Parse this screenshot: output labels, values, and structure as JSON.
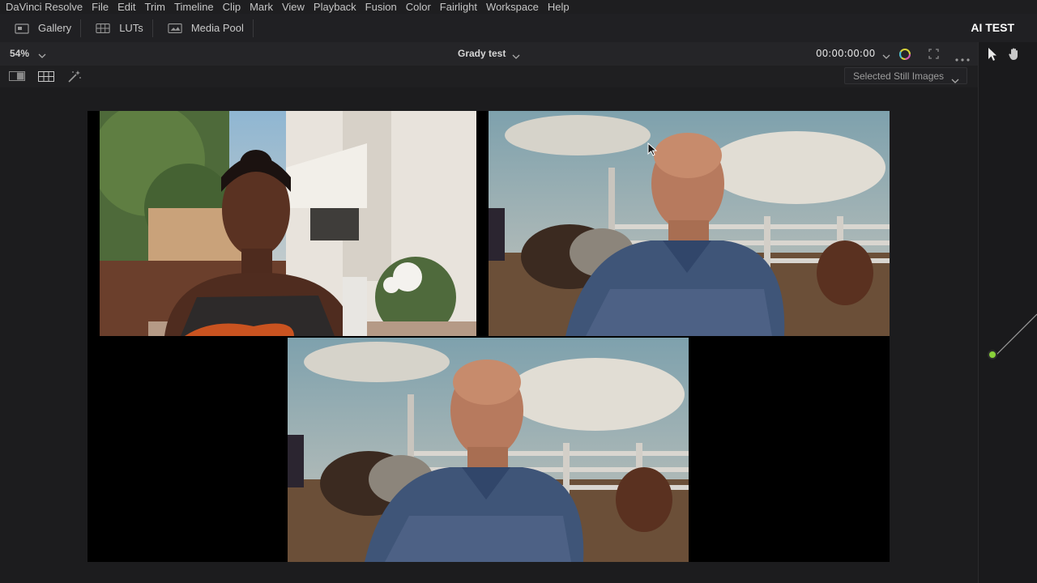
{
  "menu": [
    "DaVinci Resolve",
    "File",
    "Edit",
    "Trim",
    "Timeline",
    "Clip",
    "Mark",
    "View",
    "Playback",
    "Fusion",
    "Color",
    "Fairlight",
    "Workspace",
    "Help"
  ],
  "toolbar": {
    "gallery_label": "Gallery",
    "luts_label": "LUTs",
    "media_pool_label": "Media Pool"
  },
  "project_name": "AI TEST",
  "viewer_bar": {
    "zoom": "54%",
    "clip_name": "Grady test",
    "timecode": "00:00:00:00"
  },
  "gallery": {
    "still_filter": "Selected Still Images"
  },
  "icons": [
    "gallery-icon",
    "luts-icon",
    "media-pool-icon",
    "color-wheel-icon",
    "fullscreen-icon",
    "more-icon",
    "pointer-icon",
    "hand-icon",
    "single-view-icon",
    "grid-view-icon",
    "magic-wand-icon"
  ],
  "colors": {
    "accent_node": "#8ad13a",
    "background": "#1c1c1e"
  }
}
